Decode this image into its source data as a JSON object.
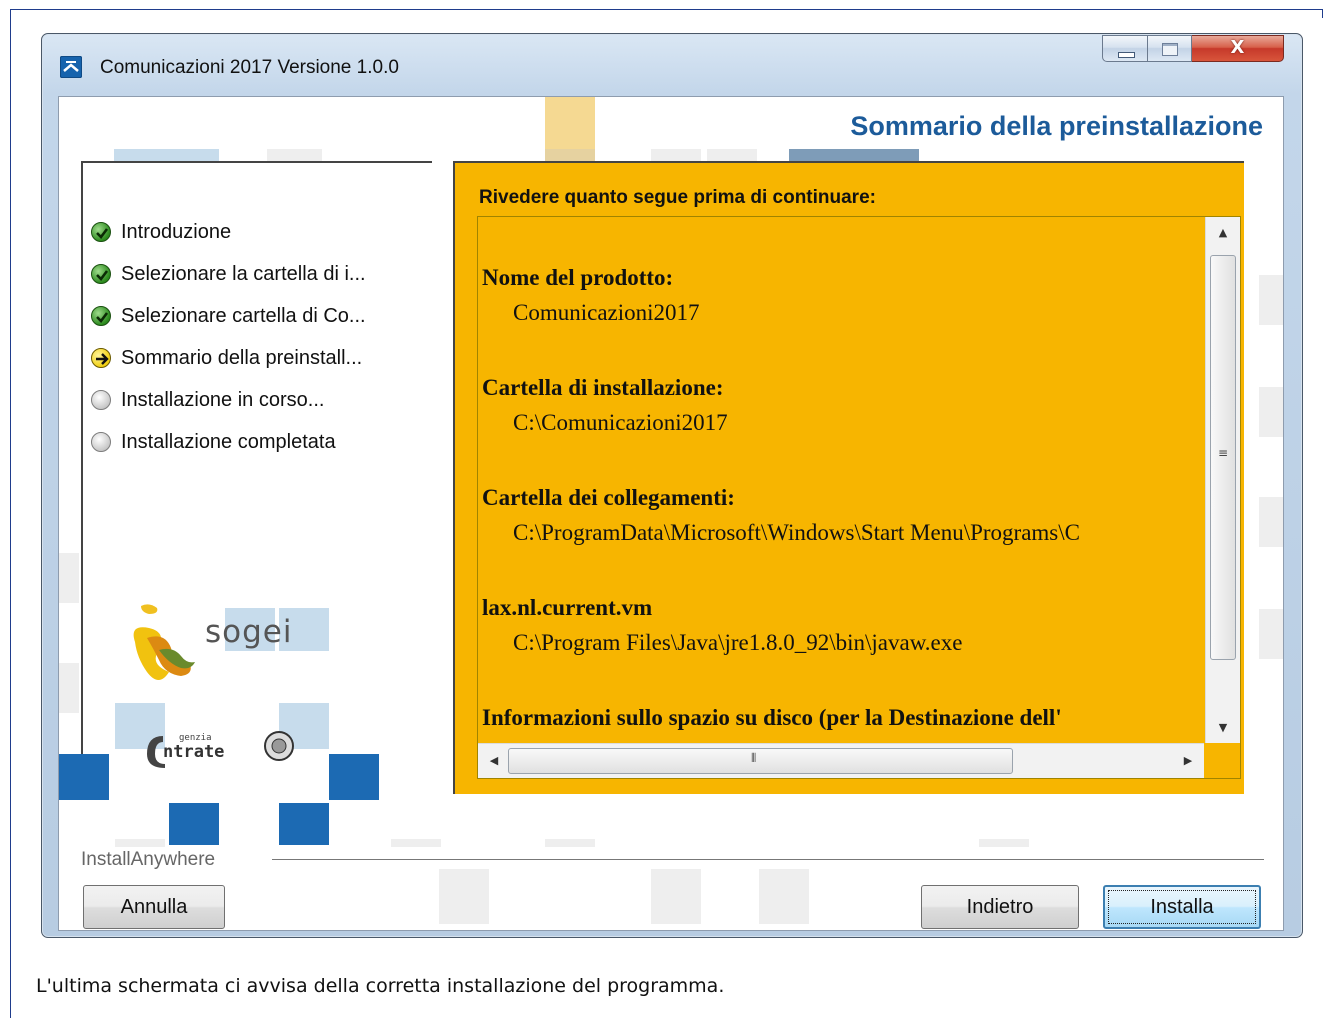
{
  "window": {
    "title": "Comunicazioni 2017 Versione 1.0.0",
    "close_glyph": "X"
  },
  "installer": {
    "heading": "Sommario della preinstallazione",
    "steps": [
      {
        "label": "Introduzione",
        "status": "done"
      },
      {
        "label": "Selezionare la cartella di i...",
        "status": "done"
      },
      {
        "label": "Selezionare cartella di Co...",
        "status": "done"
      },
      {
        "label": "Sommario della preinstall...",
        "status": "current"
      },
      {
        "label": "Installazione in corso...",
        "status": "pending"
      },
      {
        "label": "Installazione completata",
        "status": "pending"
      }
    ],
    "logos": {
      "sogei": "sogei",
      "entrate_small": "genzia",
      "entrate_main": "ntrate"
    },
    "summary": {
      "header": "Rivedere quanto segue prima di continuare:",
      "items": [
        {
          "label": "Nome del prodotto:",
          "value": "Comunicazioni2017"
        },
        {
          "label": "Cartella di installazione:",
          "value": "C:\\Comunicazioni2017"
        },
        {
          "label": "Cartella dei collegamenti:",
          "value": "C:\\ProgramData\\Microsoft\\Windows\\Start Menu\\Programs\\C"
        },
        {
          "label": "lax.nl.current.vm",
          "value": "C:\\Program Files\\Java\\jre1.8.0_92\\bin\\javaw.exe"
        },
        {
          "label": "Informazioni sullo spazio su disco (per la Destinazione dell'",
          "value": ""
        }
      ]
    },
    "brand_label": "InstallAnywhere",
    "buttons": {
      "cancel": "Annulla",
      "back": "Indietro",
      "install": "Installa"
    }
  },
  "caption": "L'ultima schermata ci avvisa della corretta installazione del programma.",
  "colors": {
    "summary_bg": "#f7b500",
    "heading": "#1c5b9a",
    "accent_blue": "#1c6ab3"
  }
}
